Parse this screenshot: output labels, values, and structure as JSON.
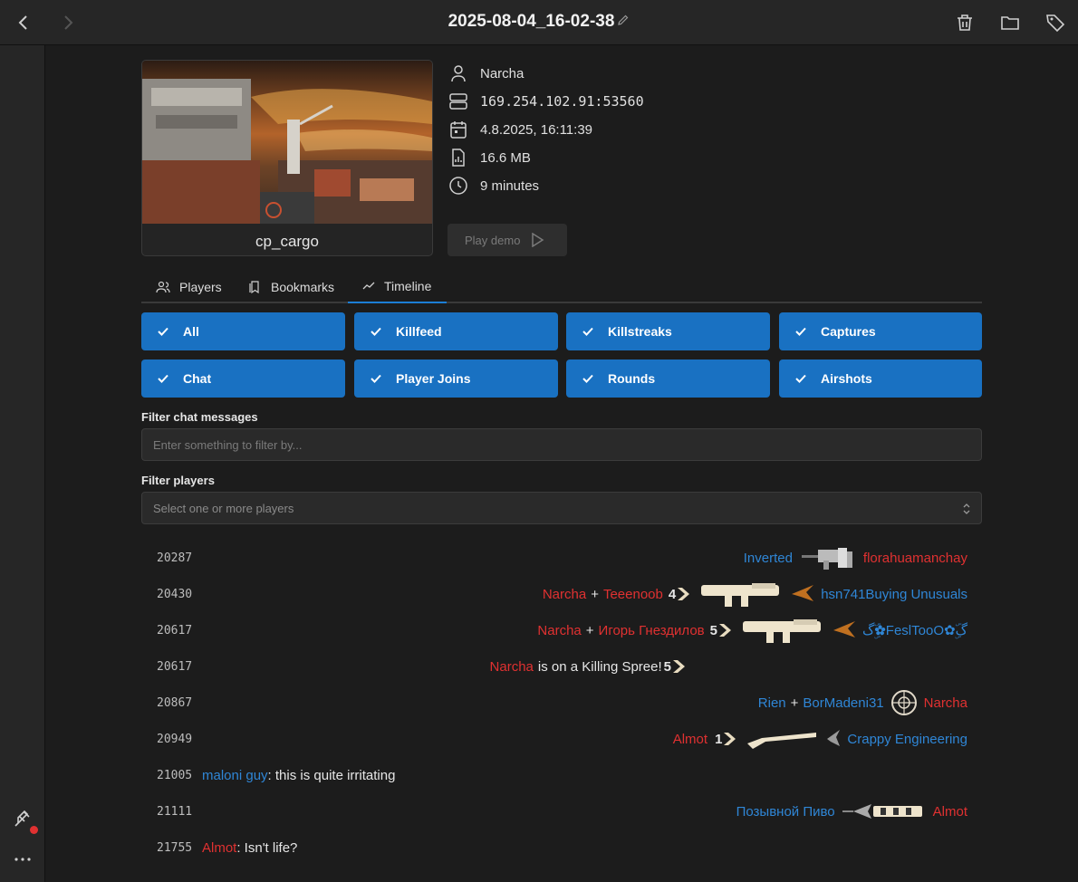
{
  "header": {
    "title": "2025-08-04_16-02-38"
  },
  "demo": {
    "map": "cp_cargo",
    "player": "Narcha",
    "server": "169.254.102.91:53560",
    "date": "4.8.2025, 16:11:39",
    "size": "16.6 MB",
    "duration": "9 minutes",
    "play_label": "Play demo"
  },
  "tabs": [
    {
      "label": "Players",
      "icon": "users-icon"
    },
    {
      "label": "Bookmarks",
      "icon": "bookmark-icon"
    },
    {
      "label": "Timeline",
      "icon": "timeline-icon",
      "active": true
    }
  ],
  "filters": [
    "All",
    "Killfeed",
    "Killstreaks",
    "Captures",
    "Chat",
    "Player Joins",
    "Rounds",
    "Airshots"
  ],
  "chat_filter": {
    "label": "Filter chat messages",
    "placeholder": "Enter something to filter by..."
  },
  "player_filter": {
    "label": "Filter players",
    "placeholder": "Select one or more players"
  },
  "colors": {
    "accent": "#1971c2",
    "red_team": "#e03131",
    "blu_team": "#2f86d6"
  },
  "timeline": [
    {
      "tick": "20287",
      "killer": "Inverted",
      "victim": "florahuamanchay"
    },
    {
      "tick": "20430",
      "killer": "Narcha",
      "assister": "Teeenoob",
      "streak": "4",
      "victim": "hsn741Buying Unusuals"
    },
    {
      "tick": "20617",
      "killer": "Narcha",
      "assister": "Игорь Гнездилов",
      "streak": "5",
      "victim": "گ✿ۣۜFeslTooO✿ۣۜگ"
    },
    {
      "tick": "20617",
      "player": "Narcha",
      "text": "is on a Killing Spree!",
      "streak": "5"
    },
    {
      "tick": "20867",
      "killer": "Rien",
      "assister": "BorMadeni31",
      "victim": "Narcha"
    },
    {
      "tick": "20949",
      "killer": "Almot",
      "streak": "1",
      "victim": "Crappy Engineering"
    },
    {
      "tick": "21005",
      "chat_player": "maloni guy",
      "chat_text": ": this is quite irritating"
    },
    {
      "tick": "21111",
      "killer": "Позывной Пиво",
      "victim": "Almot"
    },
    {
      "tick": "21755",
      "chat_player": "Almot",
      "chat_text": ": Isn't life?"
    }
  ]
}
